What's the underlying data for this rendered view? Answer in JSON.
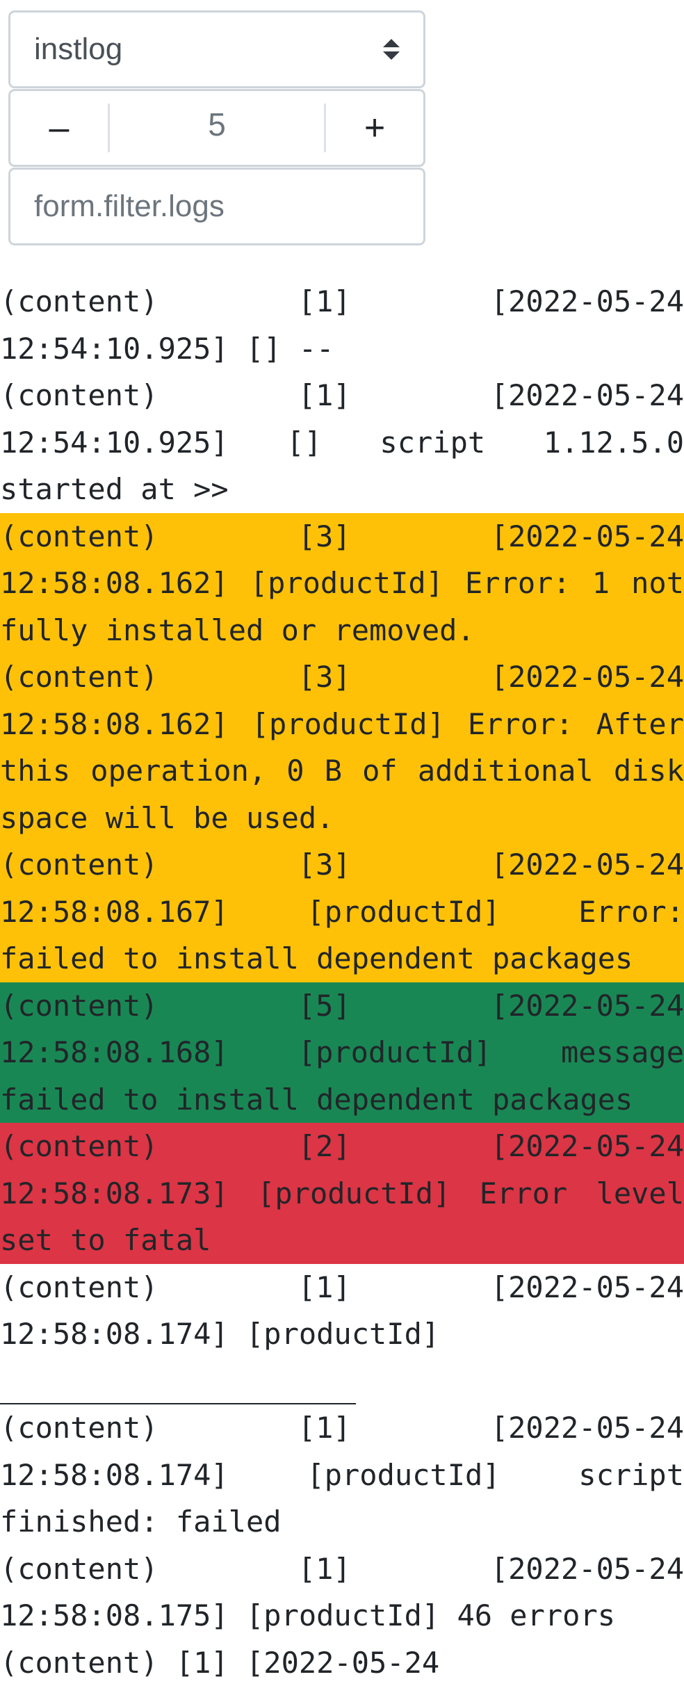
{
  "controls": {
    "log_select_value": "instlog",
    "level_value": "5",
    "decrement_label": "–",
    "increment_label": "+",
    "filter_placeholder": "form.filter.logs"
  },
  "colors": {
    "level_3_bg": "#ffc107",
    "level_5_bg": "#198754",
    "level_2_bg": "#dc3545"
  },
  "log_entries": [
    {
      "level": "1",
      "text": "(content)    [1]      [2022-05-24 12:54:10.925] [] --"
    },
    {
      "level": "1",
      "text": "(content)    [1]      [2022-05-24 12:54:10.925]  []  script  1.12.5.0 started at >>"
    },
    {
      "level": "3",
      "text": "(content)    [3]      [2022-05-24 12:58:08.162]  [productId]  Error:  1 not fully installed or removed."
    },
    {
      "level": "3",
      "text": "(content)    [3]      [2022-05-24 12:58:08.162]  [productId]  Error: After  this  operation,  0  B  of additional disk space will be used."
    },
    {
      "level": "3",
      "text": "(content)    [3]      [2022-05-24 12:58:08.167]  [productId]  Error: failed to install dependent packages"
    },
    {
      "level": "5",
      "text": "(content)    [5]      [2022-05-24 12:58:08.168]  [productId]  message failed to install dependent packages"
    },
    {
      "level": "2",
      "text": "(content)    [2]      [2022-05-24 12:58:08.173]  [productId]  Error level set to fatal"
    },
    {
      "level": "1",
      "text": "(content)    [1]      [2022-05-24 12:58:08.174]        [productId]",
      "rule": true
    },
    {
      "level": "1",
      "text": "(content)    [1]      [2022-05-24 12:58:08.174]  [productId]  script finished: failed"
    },
    {
      "level": "1",
      "text": "(content)    [1]      [2022-05-24 12:58:08.175] [productId] 46 errors"
    },
    {
      "level": "1",
      "text": "(content)    [1]      [2022-05-24"
    }
  ]
}
